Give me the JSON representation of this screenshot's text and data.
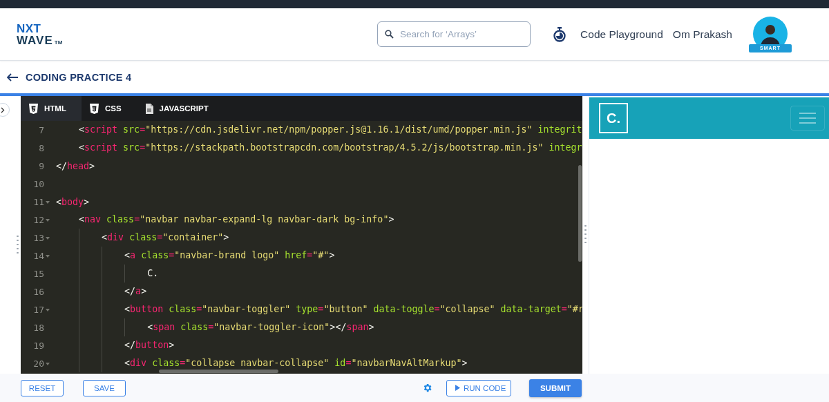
{
  "logo": {
    "top": "NXT",
    "bottom": "WAVE",
    "mark": "TM"
  },
  "search": {
    "placeholder": "Search for ‘Arrays’"
  },
  "nav_links": [
    "Code Playground",
    "Om Prakash"
  ],
  "avatar": {
    "badge": "SMART"
  },
  "page_title": "CODING PRACTICE 4",
  "editor_tabs": [
    {
      "label": "HTML",
      "kind": "html",
      "selected": true
    },
    {
      "label": "CSS",
      "kind": "css",
      "selected": false
    },
    {
      "label": "JAVASCRIPT",
      "kind": "js",
      "selected": false
    }
  ],
  "code_lines": [
    {
      "number": "7",
      "fold": false,
      "text": "    <script src=\"https://cdn.jsdelivr.net/npm/popper.js@1.16.1/dist/umd/popper.min.js\" integrit"
    },
    {
      "number": "8",
      "fold": false,
      "text": "    <script src=\"https://stackpath.bootstrapcdn.com/bootstrap/4.5.2/js/bootstrap.min.js\" integr"
    },
    {
      "number": "9",
      "fold": false,
      "text": "</head>"
    },
    {
      "number": "10",
      "fold": false
    },
    {
      "number": "11",
      "fold": true,
      "text": "<body>"
    },
    {
      "number": "12",
      "fold": true,
      "text": "    <nav class=\"navbar navbar-expand-lg navbar-dark bg-info\">"
    },
    {
      "number": "13",
      "fold": true,
      "text": "        <div class=\"container\">"
    },
    {
      "number": "14",
      "fold": true,
      "text": "            <a class=\"navbar-brand logo\" href=\"#\">"
    },
    {
      "number": "15",
      "fold": false,
      "text": "                C."
    },
    {
      "number": "16",
      "fold": false,
      "text": "            </a>"
    },
    {
      "number": "17",
      "fold": true,
      "text": "            <button class=\"navbar-toggler\" type=\"button\" data-toggle=\"collapse\" data-target=\"#r"
    },
    {
      "number": "18",
      "fold": false,
      "text": "                <span class=\"navbar-toggler-icon\"></span>"
    },
    {
      "number": "19",
      "fold": false,
      "text": "            </button>"
    },
    {
      "number": "20",
      "fold": true,
      "text": "            <div class=\"collapse navbar-collapse\" id=\"navbarNavAltMarkup\">"
    }
  ],
  "preview": {
    "brand": "C."
  },
  "actions": {
    "reset": "RESET",
    "save": "SAVE",
    "run": "RUN CODE",
    "submit": "SUBMIT"
  }
}
